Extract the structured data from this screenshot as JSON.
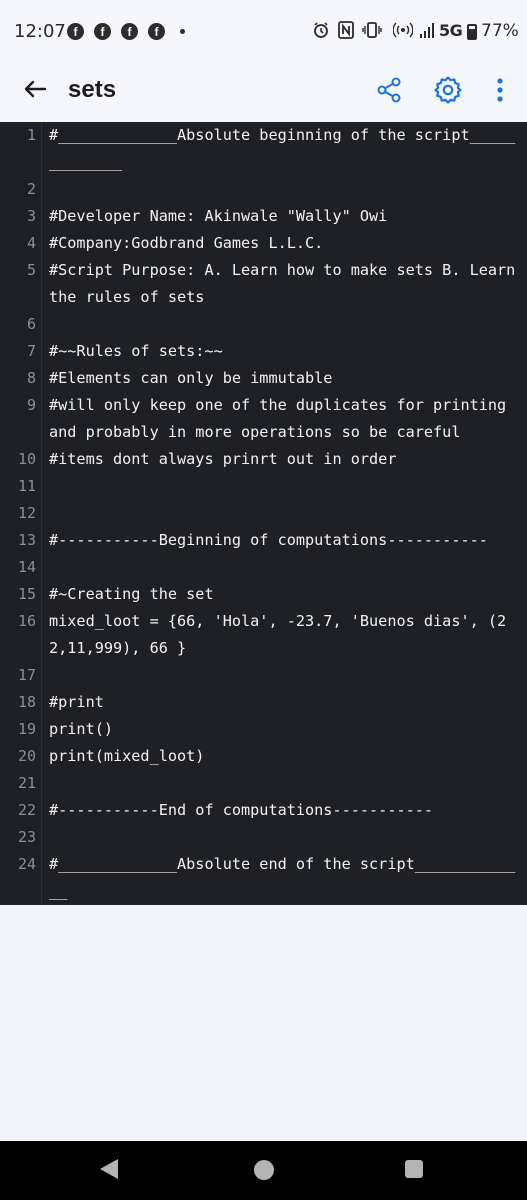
{
  "status_bar": {
    "time": "12:07",
    "network": "5G",
    "battery_percent": "77%",
    "battery_level": 0.77,
    "notification_icons": [
      "facebook-icon",
      "facebook-icon",
      "facebook-icon",
      "facebook-icon"
    ],
    "system_icons": [
      "alarm-icon",
      "nfc-icon",
      "vibrate-icon",
      "hotspot-icon",
      "signal-icon"
    ]
  },
  "app_bar": {
    "title": "sets",
    "actions": [
      "share-icon",
      "settings-icon",
      "more-vert-icon"
    ],
    "accent_color": "#1a73e8"
  },
  "editor": {
    "lines": [
      {
        "n": "1",
        "text": "#_____________Absolute beginning of the script_____________"
      },
      {
        "n": "2",
        "text": ""
      },
      {
        "n": "3",
        "text": "#Developer Name: Akinwale \"Wally\" Owi"
      },
      {
        "n": "4",
        "text": "#Company:Godbrand Games L.L.C."
      },
      {
        "n": "5",
        "text": "#Script Purpose: A. Learn how to make sets B. Learn the rules of sets"
      },
      {
        "n": "6",
        "text": ""
      },
      {
        "n": "7",
        "text": "#~~Rules of sets:~~"
      },
      {
        "n": "8",
        "text": "#Elements can only be immutable"
      },
      {
        "n": "9",
        "text": "#will only keep one of the duplicates for printing and probably in more operations so be careful"
      },
      {
        "n": "10",
        "text": "#items dont always prinrt out in order"
      },
      {
        "n": "11",
        "text": ""
      },
      {
        "n": "12",
        "text": ""
      },
      {
        "n": "13",
        "text": "#-----------Beginning of computations-----------"
      },
      {
        "n": "14",
        "text": ""
      },
      {
        "n": "15",
        "text": "#~Creating the set"
      },
      {
        "n": "16",
        "text": "mixed_loot = {66, 'Hola', -23.7, 'Buenos dias', (22,11,999), 66 }"
      },
      {
        "n": "17",
        "text": ""
      },
      {
        "n": "18",
        "text": "#print"
      },
      {
        "n": "19",
        "text": "print()"
      },
      {
        "n": "20",
        "text": "print(mixed_loot)"
      },
      {
        "n": "21",
        "text": ""
      },
      {
        "n": "22",
        "text": "#-----------End of computations-----------"
      },
      {
        "n": "23",
        "text": ""
      },
      {
        "n": "24",
        "text": "#_____________Absolute end of the script_____________"
      }
    ]
  },
  "nav_bar": {
    "buttons": [
      "back-nav-icon",
      "home-nav-icon",
      "recent-apps-icon"
    ]
  }
}
